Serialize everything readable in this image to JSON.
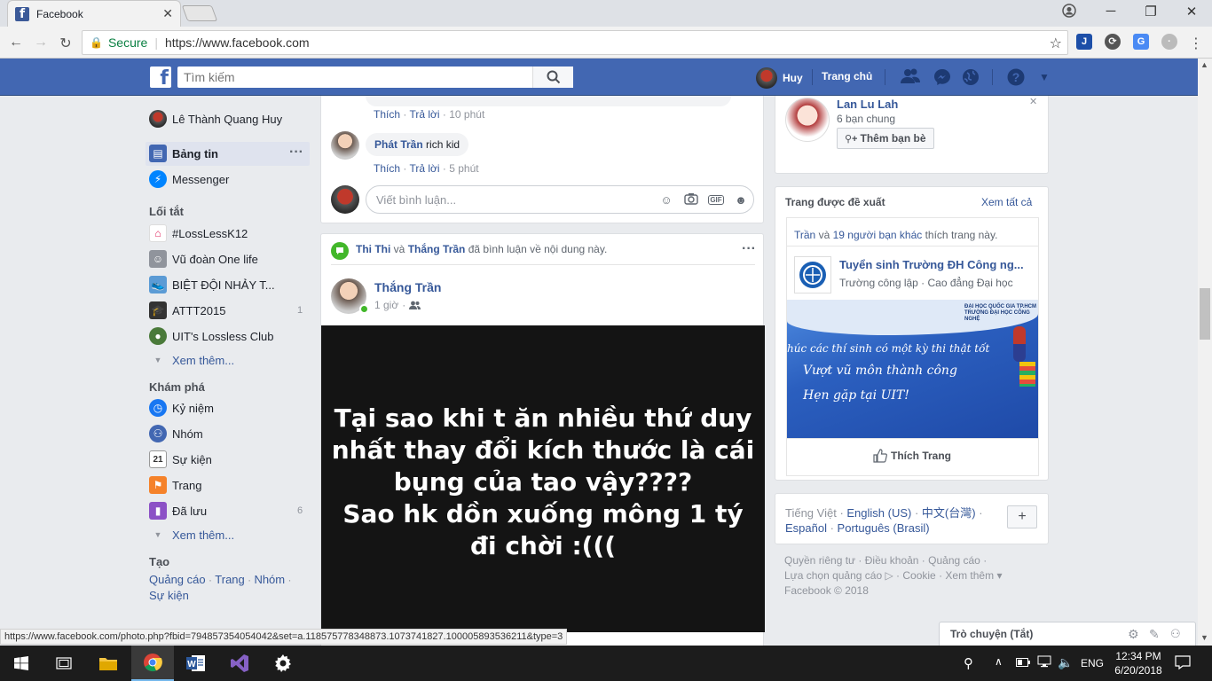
{
  "browser": {
    "tab_title": "Facebook",
    "secure_label": "Secure",
    "url": "https://www.facebook.com",
    "status_url": "https://www.facebook.com/photo.php?fbid=794857354054042&set=a.118575778348873.1073741827.100005893536211&type=3"
  },
  "fb_header": {
    "search_placeholder": "Tìm kiếm",
    "profile_name": "Huy",
    "home_label": "Trang chủ"
  },
  "left_nav": {
    "user_name": "Lê Thành Quang Huy",
    "news_feed": "Bảng tin",
    "messenger": "Messenger",
    "shortcuts_title": "Lối tắt",
    "shortcuts": [
      {
        "label": "#LossLessK12",
        "count": ""
      },
      {
        "label": "Vũ đoàn One life",
        "count": ""
      },
      {
        "label": "BIỆT ĐỘI NHẢY T...",
        "count": ""
      },
      {
        "label": "ATTT2015",
        "count": "1"
      },
      {
        "label": "UIT's Lossless Club",
        "count": ""
      }
    ],
    "see_more_1": "Xem thêm...",
    "explore_title": "Khám phá",
    "explore": [
      {
        "label": "Kỷ niệm",
        "count": ""
      },
      {
        "label": "Nhóm",
        "count": ""
      },
      {
        "label": "Sự kiện",
        "count": ""
      },
      {
        "label": "Trang",
        "count": ""
      },
      {
        "label": "Đã lưu",
        "count": "6"
      }
    ],
    "see_more_2": "Xem thêm...",
    "create_title": "Tạo",
    "create_links": [
      "Quảng cáo",
      "Trang",
      "Nhóm",
      "Sự kiện"
    ]
  },
  "comments": [
    {
      "author": "",
      "text": "",
      "like": "Thích",
      "reply": "Trả lời",
      "time": "10 phút"
    },
    {
      "author": "Phát Trần",
      "text": "rich kid",
      "like": "Thích",
      "reply": "Trả lời",
      "time": "5 phút"
    }
  ],
  "comment_input_placeholder": "Viết bình luận...",
  "post": {
    "activity_user1": "Thi Thi",
    "activity_and": "và",
    "activity_user2": "Thắng Trần",
    "activity_text": "đã bình luận về nội dung này.",
    "author": "Thắng Trần",
    "time": "1 giờ",
    "image_text_lines": [
      "Tại sao khi t ăn nhiều thứ duy",
      "nhất thay đổi kích thước là cái",
      "bụng của tao vậy????",
      "Sao hk dồn xuống mông 1 tý",
      "đi chời :((("
    ]
  },
  "friend_suggestion": {
    "name": "Lan Lu Lah",
    "mutual": "6 bạn chung",
    "add_button": "Thêm bạn bè"
  },
  "suggested_pages": {
    "title": "Trang được đề xuất",
    "see_all": "Xem tất cả",
    "liked_by_name": "Trần",
    "liked_by_and": "và",
    "liked_by_others": "19 người bạn khác",
    "liked_by_suffix": "thích trang này.",
    "page_name": "Tuyển sinh Trường ĐH Công ng...",
    "page_desc": "Trường công lập · Cao đẳng Đại học",
    "banner_header_1": "ĐẠI HỌC QUỐC GIA TP.HCM",
    "banner_header_2": "TRƯỜNG ĐẠI HỌC CÔNG NGHỆ",
    "banner_line1": "húc các thí sinh có một kỳ thi thật tốt",
    "banner_line2": "Vượt vũ môn thành công",
    "banner_line3": "Hẹn gặp tại UIT!",
    "like_page": "Thích Trang"
  },
  "languages": {
    "current": "Tiếng Việt",
    "options": [
      "English (US)",
      "中文(台灣)",
      "Español",
      "Português (Brasil)"
    ]
  },
  "footer": {
    "links": [
      "Quyền riêng tư",
      "Điều khoản",
      "Quảng cáo",
      "Lựa chọn quảng cáo",
      "Cookie",
      "Xem thêm"
    ],
    "copyright": "Facebook © 2018"
  },
  "chat": {
    "label": "Trò chuyện (Tắt)"
  },
  "taskbar": {
    "lang": "ENG",
    "time": "12:34 PM",
    "date": "6/20/2018"
  }
}
